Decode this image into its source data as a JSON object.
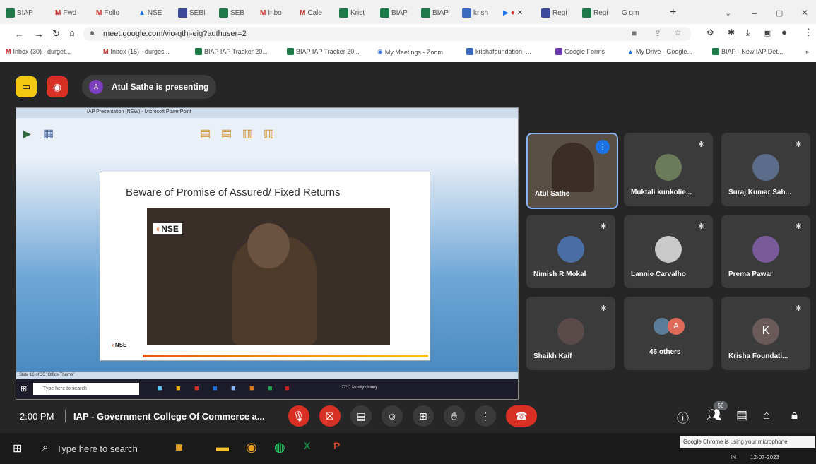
{
  "browser": {
    "tabs": [
      "BIAP",
      "Fwd",
      "Follo",
      "NSE",
      "SEBI",
      "SEB",
      "Inbo",
      "Cale",
      "Krist",
      "BIAP",
      "BIAP",
      "krish",
      "",
      "Regi",
      "Regi",
      "G gm"
    ],
    "url": "meet.google.com/vio-qthj-eig?authuser=2",
    "bookmarks": [
      "Inbox (30) - durget...",
      "Inbox (15) - durges...",
      "BIAP IAP Tracker 20...",
      "BIAP IAP Tracker 20...",
      "My Meetings - Zoom",
      "krishafoundation -...",
      "Google Forms",
      "My Drive - Google...",
      "BIAP - New IAP Det..."
    ]
  },
  "meet": {
    "presenting_label": "Atul Sathe is presenting",
    "presenter_initial": "A",
    "time": "2:00 PM",
    "meeting_title": "IAP - Government College Of Commerce a...",
    "participant_count": "56",
    "slide": {
      "title": "Beware of Promise of Assured/ Fixed Returns",
      "video_logo": "NSE",
      "footer_logo": "NSE",
      "ppt_title": "IAP Presentation (NEW) - Microsoft PowerPoint",
      "win_taskbar_search": "Type here to search",
      "win_status": "27°C Mostly cloudy",
      "status_bar": "Slide 16 of 35  \"Office Theme\""
    },
    "participants": [
      {
        "name": "Atul Sathe",
        "avatar_color": "#5a4a3a"
      },
      {
        "name": "Muktali kunkolie...",
        "avatar_color": "#6b7b5a"
      },
      {
        "name": "Suraj Kumar Sah...",
        "avatar_color": "#5b6d8a"
      },
      {
        "name": "Nimish R Mokal",
        "avatar_color": "#4a6fa5"
      },
      {
        "name": "Lannie Carvalho",
        "avatar_color": "#c9c9c9"
      },
      {
        "name": "Prema Pawar",
        "avatar_color": "#7a5a9a"
      },
      {
        "name": "Shaikh Kaif",
        "avatar_color": "#5a4a4a"
      },
      {
        "name": "46 others",
        "avatar_color": "#e06a5a",
        "avatar_letter": "A"
      },
      {
        "name": "Krisha Foundati...",
        "avatar_color": "#6a5a5a",
        "avatar_letter": "K"
      }
    ],
    "tooltip": "Google Chrome is using your microphone"
  },
  "taskbar": {
    "search_placeholder": "Type here to search",
    "tray_lang": "IN",
    "tray_date": "12-07-2023"
  }
}
